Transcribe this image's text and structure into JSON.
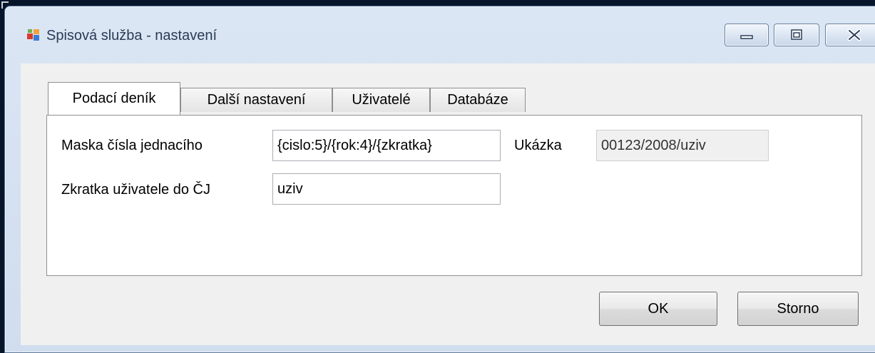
{
  "window": {
    "title": "Spisová služba - nastavení"
  },
  "tabs": [
    {
      "label": "Podací deník",
      "active": true
    },
    {
      "label": "Další nastavení",
      "active": false
    },
    {
      "label": "Uživatelé",
      "active": false
    },
    {
      "label": "Databáze",
      "active": false
    }
  ],
  "form": {
    "mask_label": "Maska čísla jednacího",
    "mask_value": "{cislo:5}/{rok:4}/{zkratka}",
    "preview_label": "Ukázka",
    "preview_value": "00123/2008/uziv",
    "abbr_label": "Zkratka uživatele do ČJ",
    "abbr_value": "uziv"
  },
  "buttons": {
    "ok": "OK",
    "cancel": "Storno"
  },
  "icons": {
    "app": "app-window-icon",
    "minimize": "minimize-icon",
    "maximize": "maximize-icon",
    "close": "close-icon"
  },
  "colors": {
    "desktop": "#06152a",
    "frame": "#dbe6f4",
    "client": "#f0f0f0"
  }
}
